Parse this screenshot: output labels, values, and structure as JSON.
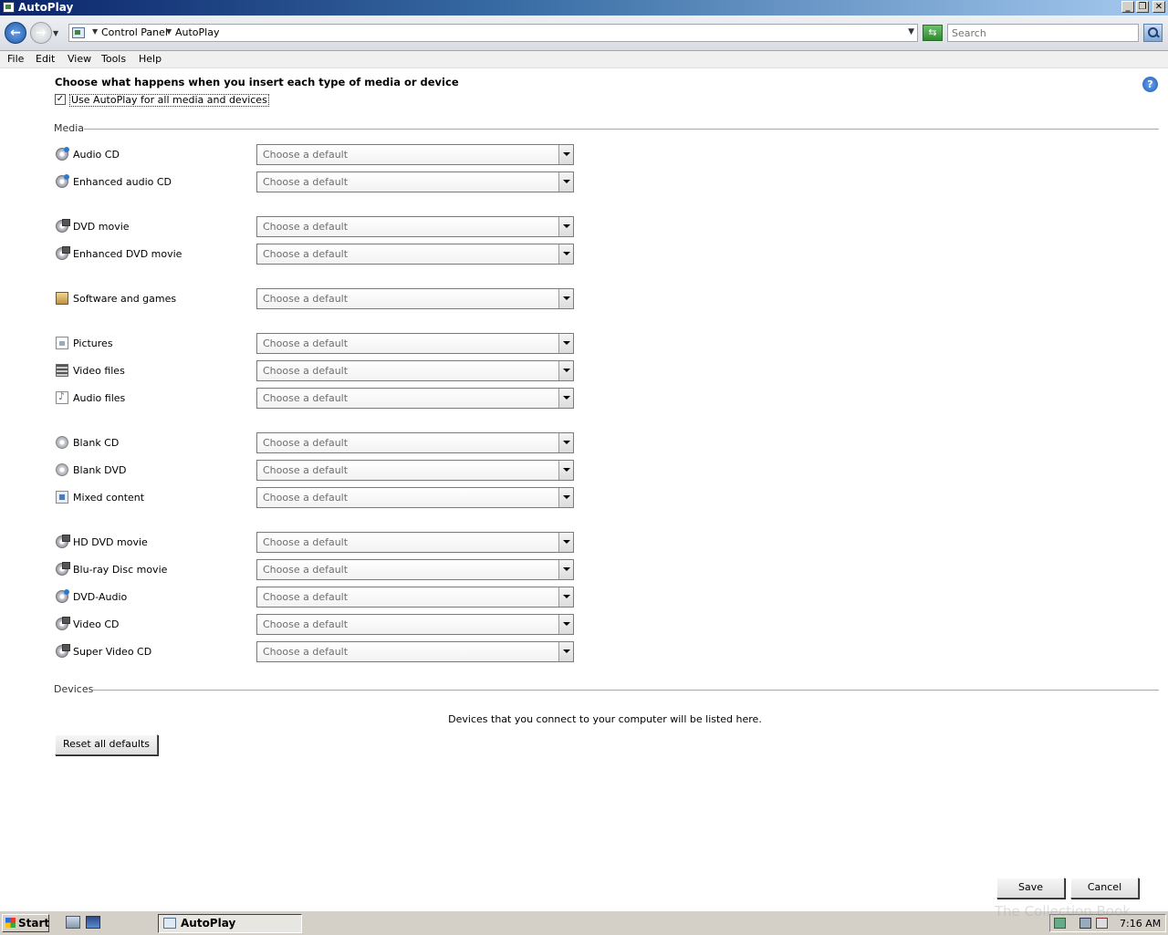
{
  "window": {
    "title": "AutoPlay"
  },
  "address": {
    "breadcrumbs": [
      "Control Panel",
      "AutoPlay"
    ],
    "search_placeholder": "Search"
  },
  "menu": [
    "File",
    "Edit",
    "View",
    "Tools",
    "Help"
  ],
  "content": {
    "heading": "Choose what happens when you insert each type of media or device",
    "use_autoplay": {
      "label": "Use AutoPlay for all media and devices",
      "checked": true
    },
    "media_section": "Media",
    "combo_placeholder": "Choose a default",
    "media": [
      {
        "label": "Audio CD",
        "icon": "audio-cd-icon"
      },
      {
        "label": "Enhanced audio CD",
        "icon": "enhanced-audio-cd-icon"
      },
      {
        "label": "DVD movie",
        "icon": "dvd-movie-icon"
      },
      {
        "label": "Enhanced DVD movie",
        "icon": "enhanced-dvd-movie-icon"
      },
      {
        "label": "Software and games",
        "icon": "software-games-icon"
      },
      {
        "label": "Pictures",
        "icon": "pictures-icon"
      },
      {
        "label": "Video files",
        "icon": "video-files-icon"
      },
      {
        "label": "Audio files",
        "icon": "audio-files-icon"
      },
      {
        "label": "Blank CD",
        "icon": "blank-cd-icon"
      },
      {
        "label": "Blank DVD",
        "icon": "blank-dvd-icon"
      },
      {
        "label": "Mixed content",
        "icon": "mixed-content-icon"
      },
      {
        "label": "HD DVD movie",
        "icon": "hd-dvd-movie-icon"
      },
      {
        "label": "Blu-ray Disc movie",
        "icon": "bluray-disc-movie-icon"
      },
      {
        "label": "DVD-Audio",
        "icon": "dvd-audio-icon"
      },
      {
        "label": "Video CD",
        "icon": "video-cd-icon"
      },
      {
        "label": "Super Video CD",
        "icon": "super-video-cd-icon"
      }
    ],
    "devices_section": "Devices",
    "devices_message": "Devices that you connect to your computer will be listed here.",
    "reset_button": "Reset all defaults",
    "save_button": "Save",
    "cancel_button": "Cancel"
  },
  "taskbar": {
    "start": "Start",
    "task": "AutoPlay",
    "clock": "7:16 AM"
  },
  "watermark": "The Collection Book",
  "colors": {
    "titlebar": "#0a246a",
    "accent": "#2f78d0",
    "taskbar": "#d4d0c8"
  }
}
